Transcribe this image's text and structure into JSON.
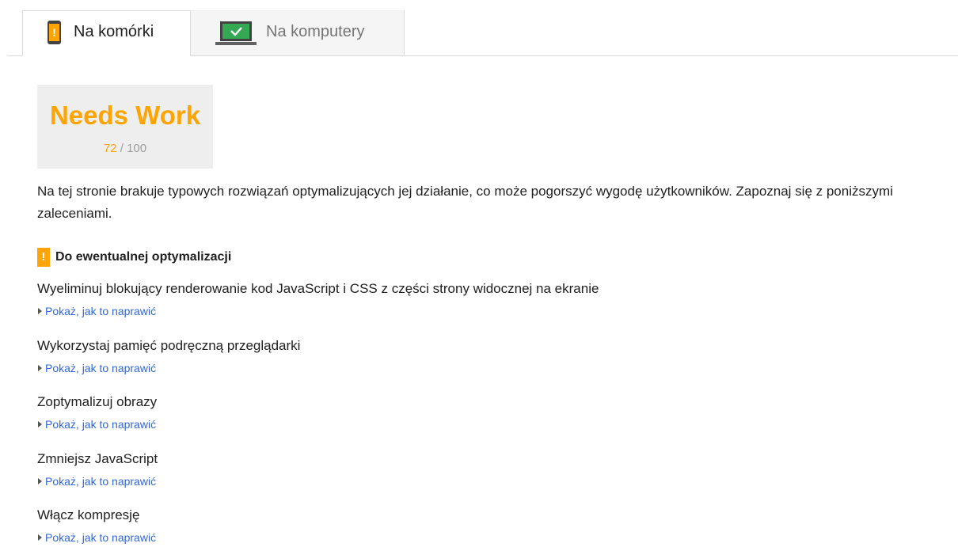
{
  "tabs": [
    {
      "label": "Na komórki",
      "icon": "phone-warning-icon",
      "active": true
    },
    {
      "label": "Na komputery",
      "icon": "laptop-check-icon",
      "active": false
    }
  ],
  "score": {
    "title": "Needs Work",
    "value": "72",
    "separator": " / ",
    "max": "100",
    "color": "#ffa400"
  },
  "summary": "Na tej stronie brakuje typowych rozwiązań optymalizujących jej działanie, co może pogorszyć wygodę użytkowników. Zapoznaj się z poniższymi zaleceniami.",
  "section": {
    "badge": "!",
    "title": "Do ewentualnej optymalizacji"
  },
  "rules": [
    {
      "title": "Wyeliminuj blokujący renderowanie kod JavaScript i CSS z części strony widocznej na ekranie",
      "link": "Pokaż, jak to naprawić"
    },
    {
      "title": "Wykorzystaj pamięć podręczną przeglądarki",
      "link": "Pokaż, jak to naprawić"
    },
    {
      "title": "Zoptymalizuj obrazy",
      "link": "Pokaż, jak to naprawić"
    },
    {
      "title": "Zmniejsz JavaScript",
      "link": "Pokaż, jak to naprawić"
    },
    {
      "title": "Włącz kompresję",
      "link": "Pokaż, jak to naprawić"
    }
  ],
  "colors": {
    "accent": "#ffa400",
    "link": "#3367d6",
    "laptop_screen": "#34a853"
  }
}
